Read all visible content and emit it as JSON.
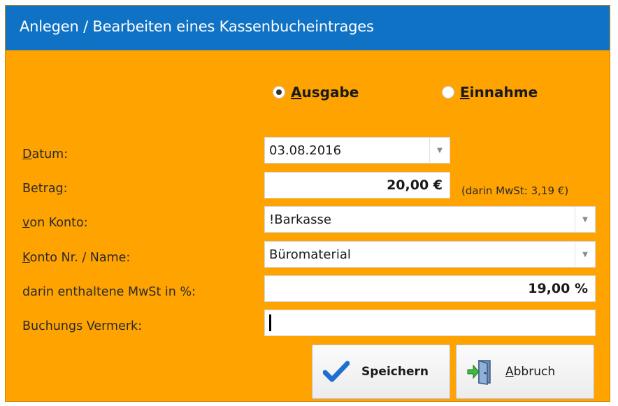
{
  "window": {
    "title": "Anlegen / Bearbeiten eines Kassenbucheintrages"
  },
  "type_radio": {
    "ausgabe": {
      "label": "Ausgabe",
      "checked": true
    },
    "einnahme": {
      "label": "Einnahme",
      "checked": false
    }
  },
  "form": {
    "datum": {
      "label": "Datum:",
      "value": "03.08.2016"
    },
    "betrag": {
      "label": "Betrag:",
      "value": "20,00 €",
      "hint": "(darin MwSt: 3,19 €)"
    },
    "von_konto": {
      "label": "von Konto:",
      "value": "!Barkasse"
    },
    "konto_nr": {
      "label": "Konto Nr. / Name:",
      "value": "Büromaterial"
    },
    "mwst": {
      "label": "darin enthaltene MwSt in %:",
      "value": "19,00 %"
    },
    "vermerk": {
      "label": "Buchungs Vermerk:",
      "value": ""
    }
  },
  "buttons": {
    "save": {
      "label": "Speichern",
      "icon": "checkmark-icon"
    },
    "cancel": {
      "label": "Abbruch",
      "icon": "exit-door-icon"
    }
  },
  "colors": {
    "titlebar": "#0F72C4",
    "background": "#FFA300",
    "check": "#1E6FD0"
  }
}
